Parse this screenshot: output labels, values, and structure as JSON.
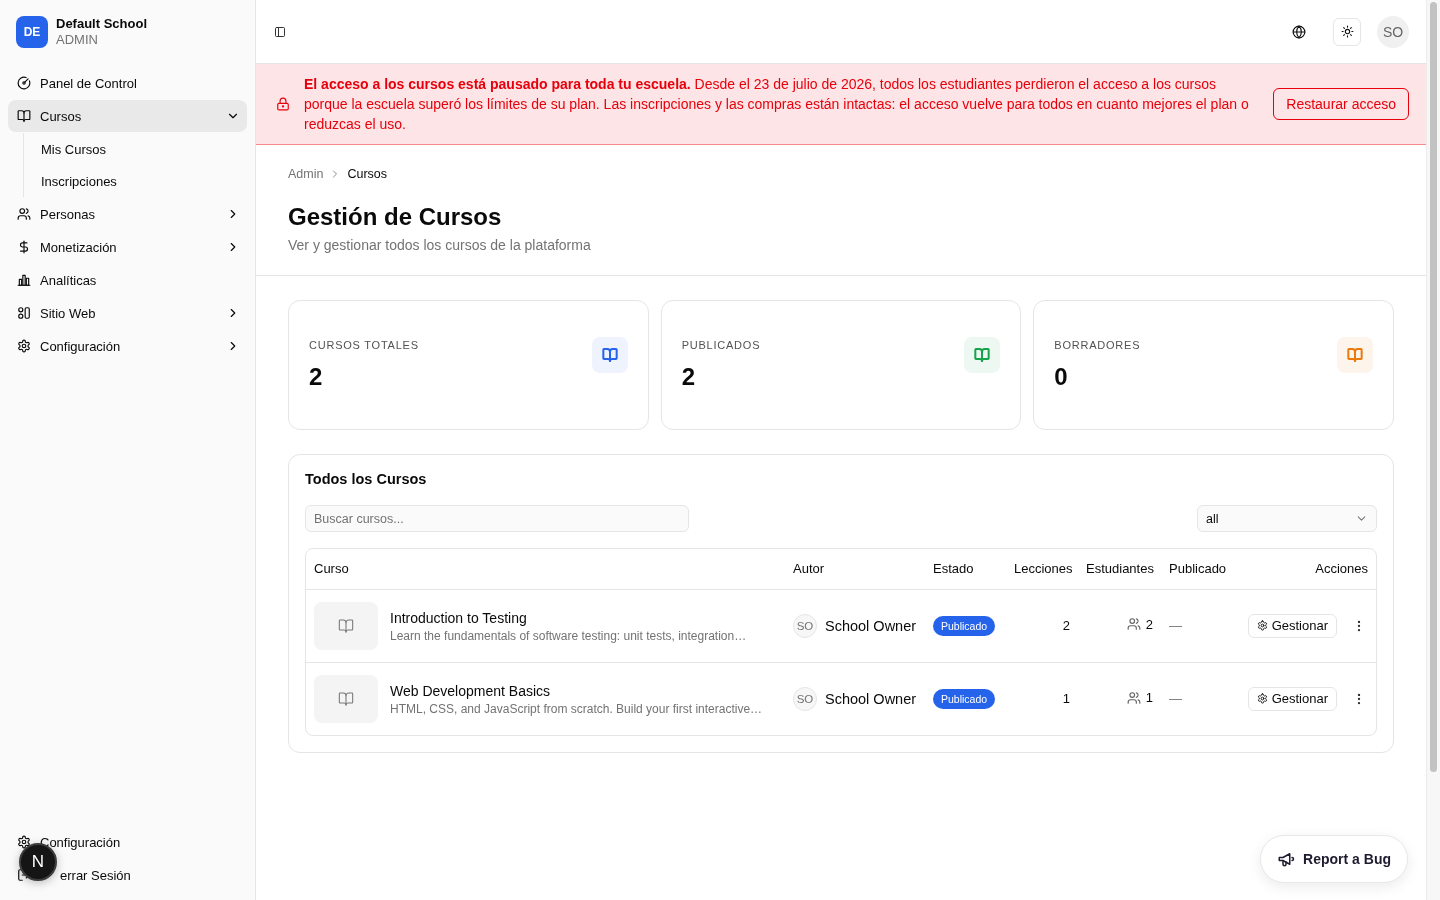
{
  "sidebar": {
    "brand": {
      "initials": "DE",
      "name": "Default School",
      "role": "ADMIN"
    },
    "nav": [
      {
        "kind": "link",
        "label": "Panel de Control",
        "selected": false
      },
      {
        "kind": "group",
        "label": "Cursos",
        "selected": true,
        "expanded": true,
        "children": [
          {
            "label": "Mis Cursos",
            "selected": false
          },
          {
            "label": "Inscripciones",
            "selected": false
          }
        ]
      },
      {
        "kind": "group",
        "label": "Personas",
        "selected": false,
        "expanded": false
      },
      {
        "kind": "group",
        "label": "Monetización",
        "selected": false,
        "expanded": false
      },
      {
        "kind": "link",
        "label": "Analíticas",
        "selected": false
      },
      {
        "kind": "group",
        "label": "Sitio Web",
        "selected": false,
        "expanded": false
      },
      {
        "kind": "group",
        "label": "Configuración",
        "selected": false,
        "expanded": false
      }
    ],
    "footer": [
      {
        "label": "Configuración"
      },
      {
        "label": "errar Sesión"
      }
    ]
  },
  "topbar": {
    "avatar": "SO"
  },
  "alert": {
    "message": "**El acceso a los cursos está pausado para toda tu escuela.** Desde el 23 de julio de 2026, todos los estudiantes perdieron el acceso a los cursos porque la escuela superó los límites de su plan. Las inscripciones y las compras están intactas: el acceso vuelve para todos en cuanto mejores el plan o reduzcas el uso.",
    "button": "Restaurar acceso"
  },
  "breadcrumb": [
    {
      "label": "Admin",
      "current": false
    },
    {
      "label": "Cursos",
      "current": true
    }
  ],
  "page": {
    "title": "Gestión de Cursos",
    "subtitle": "Ver y gestionar todos los cursos de la plataforma"
  },
  "stats": [
    {
      "label": "CURSOS TOTALES",
      "value": "2",
      "color": "#2563eb"
    },
    {
      "label": "PUBLICADOS",
      "value": "2",
      "color": "#16a34a"
    },
    {
      "label": "BORRADORES",
      "value": "0",
      "color": "#ea7a0c"
    }
  ],
  "courses": {
    "title": "Todos los Cursos",
    "search": {
      "placeholder": "Buscar cursos..."
    },
    "filter": {
      "value": "all"
    },
    "columns": [
      "Curso",
      "Autor",
      "Estado",
      "Lecciones",
      "Estudiantes",
      "Publicado",
      "Acciones"
    ],
    "rows": [
      {
        "title": "Introduction to Testing",
        "description": "Learn the fundamentals of software testing: unit tests, integration…",
        "author_initials": "SO",
        "author": "School Owner",
        "status": "Publicado",
        "lessons": "2",
        "students": "2",
        "published": "—",
        "action": "Gestionar"
      },
      {
        "title": "Web Development Basics",
        "description": "HTML, CSS, and JavaScript from scratch. Build your first interactive…",
        "author_initials": "SO",
        "author": "School Owner",
        "status": "Publicado",
        "lessons": "1",
        "students": "1",
        "published": "—",
        "action": "Gestionar"
      }
    ]
  },
  "report_button": {
    "label": "Report a Bug"
  },
  "dev_badge": {
    "label": "N"
  }
}
